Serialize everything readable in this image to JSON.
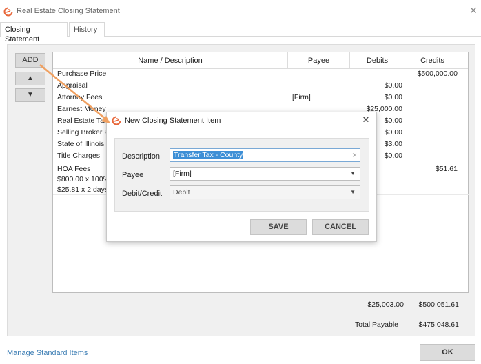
{
  "window": {
    "title": "Real Estate Closing Statement",
    "close_glyph": "✕"
  },
  "tabs": [
    {
      "label": "Closing Statement",
      "active": true
    },
    {
      "label": "History",
      "active": false
    }
  ],
  "side_buttons": {
    "add": "ADD",
    "up": "▲",
    "down": "▼"
  },
  "table": {
    "columns": [
      "Name / Description",
      "Payee",
      "Debits",
      "Credits"
    ],
    "rows": [
      {
        "name": "Purchase Price",
        "payee": "",
        "debit": "",
        "credit": "$500,000.00"
      },
      {
        "name": "Appraisal",
        "payee": "",
        "debit": "$0.00",
        "credit": ""
      },
      {
        "name": "Attorney Fees",
        "payee": "[Firm]",
        "debit": "$0.00",
        "credit": ""
      },
      {
        "name": "Earnest Money",
        "payee": "",
        "debit": "$25,000.00",
        "credit": ""
      },
      {
        "name": "Real Estate Taxes",
        "payee": "",
        "debit": "$0.00",
        "credit": ""
      },
      {
        "name": "Selling Broker Fee",
        "payee": "",
        "debit": "$0.00",
        "credit": ""
      },
      {
        "name": "State of Illinois",
        "payee": "",
        "debit": "$3.00",
        "credit": ""
      },
      {
        "name": "Title Charges",
        "payee": "",
        "debit": "$0.00",
        "credit": ""
      },
      {
        "name": "HOA Fees",
        "name_line2": "$800.00 x 100%",
        "name_line3": "$25.81 x 2 days",
        "payee": "",
        "debit": "",
        "credit": "$51.61"
      }
    ],
    "totals": {
      "debit": "$25,003.00",
      "credit": "$500,051.61"
    },
    "total_payable": {
      "label": "Total Payable",
      "value": "$475,048.61"
    }
  },
  "footer": {
    "manage_link": "Manage Standard Items",
    "ok": "OK"
  },
  "modal": {
    "title": "New Closing Statement Item",
    "close_glyph": "✕",
    "description": {
      "label": "Description",
      "value": "Transfer Tax - County",
      "clear_glyph": "×"
    },
    "payee": {
      "label": "Payee",
      "value": "[Firm]"
    },
    "debit_credit": {
      "label": "Debit/Credit",
      "value": "Debit"
    },
    "save": "SAVE",
    "cancel": "CANCEL"
  },
  "colors": {
    "accent_logo": "#e8673a",
    "link": "#3f7fb5",
    "selection": "#3d8fd6",
    "arrow": "#f0a060"
  }
}
